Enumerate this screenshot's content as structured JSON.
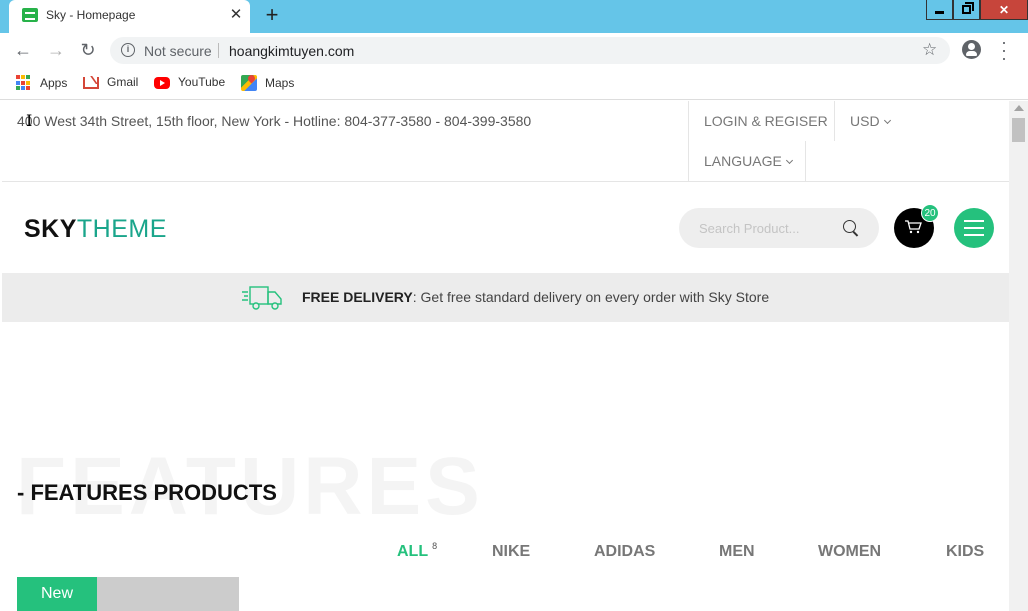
{
  "browser": {
    "tab_title": "Sky - Homepage",
    "tab_close": "✕",
    "new_tab": "+",
    "not_secure": "Not secure",
    "url": "hoangkimtuyen.com",
    "bookmarks": [
      {
        "label": "Apps",
        "icon": "apps-grid-icon"
      },
      {
        "label": "Gmail",
        "icon": "gmail-icon"
      },
      {
        "label": "YouTube",
        "icon": "youtube-icon"
      },
      {
        "label": "Maps",
        "icon": "maps-icon"
      }
    ],
    "titlebar_color": "#65c5e8"
  },
  "site": {
    "topbar": {
      "address": "400 West 34th Street, 15th floor, New York - Hotline: 804-377-3580 - 804-399-3580",
      "login": "LOGIN & REGISER",
      "currency": "USD",
      "language": "LANGUAGE"
    },
    "logo": {
      "part1": "SKY",
      "part2": "THEME"
    },
    "search": {
      "placeholder": "Search Product..."
    },
    "cart": {
      "count": "20"
    },
    "delivery": {
      "bold": "FREE DELIVERY",
      "text": ": Get free standard delivery on every order with Sky Store"
    },
    "features": {
      "background_word": "FEATURES",
      "title": "- FEATURES PRODUCTS",
      "filters": [
        {
          "label": "ALL",
          "count": "8",
          "active": true
        },
        {
          "label": "NIKE"
        },
        {
          "label": "ADIDAS"
        },
        {
          "label": "MEN"
        },
        {
          "label": "WOMEN"
        },
        {
          "label": "KIDS"
        }
      ]
    },
    "product": {
      "badge": "New"
    },
    "colors": {
      "accent": "#25c17d",
      "logo_teal": "#1aa58b",
      "delivery_bg": "#ececec"
    }
  }
}
